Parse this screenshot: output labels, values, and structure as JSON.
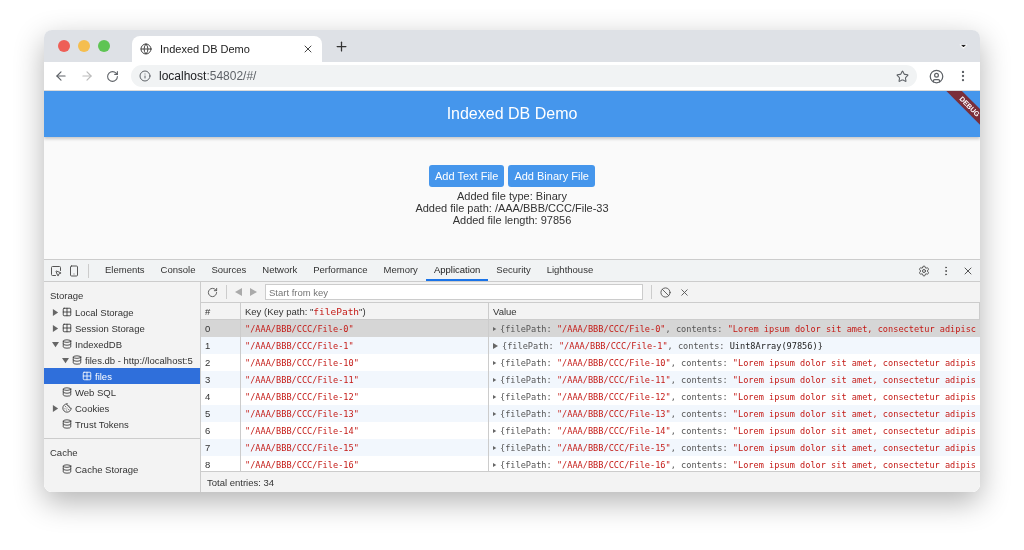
{
  "browser": {
    "tab_title": "Indexed DB Demo",
    "url_host": "localhost",
    "url_rest": ":54802/#/"
  },
  "app": {
    "title": "Indexed DB Demo",
    "debug_banner": "DEBUG",
    "buttons": [
      "Add Text File",
      "Add Binary File"
    ],
    "lines": [
      "Added file type: Binary",
      "Added file path: /AAA/BBB/CCC/File-33",
      "Added file length: 97856"
    ]
  },
  "devtools": {
    "tabs": [
      {
        "label": "Elements",
        "selected": false
      },
      {
        "label": "Console",
        "selected": false
      },
      {
        "label": "Sources",
        "selected": false
      },
      {
        "label": "Network",
        "selected": false
      },
      {
        "label": "Performance",
        "selected": false
      },
      {
        "label": "Memory",
        "selected": false
      },
      {
        "label": "Application",
        "selected": true
      },
      {
        "label": "Security",
        "selected": false
      },
      {
        "label": "Lighthouse",
        "selected": false
      }
    ],
    "sidebar": [
      {
        "heading": "Storage",
        "items": [
          {
            "label": "Local Storage",
            "kind": "grid",
            "expanded": false,
            "selected": false
          },
          {
            "label": "Session Storage",
            "kind": "grid",
            "expanded": false,
            "selected": false
          },
          {
            "label": "IndexedDB",
            "kind": "db",
            "expanded": true,
            "selected": false,
            "children": [
              {
                "label": "files.db - http://localhost:5",
                "kind": "db",
                "expanded": true,
                "selected": false,
                "children": [
                  {
                    "label": "files",
                    "kind": "grid",
                    "selected": true
                  }
                ]
              }
            ]
          },
          {
            "label": "Web SQL",
            "kind": "db",
            "selected": false
          },
          {
            "label": "Cookies",
            "kind": "cookie",
            "expanded": false,
            "selected": false
          },
          {
            "label": "Trust Tokens",
            "kind": "db",
            "selected": false
          }
        ]
      },
      {
        "heading": "Cache",
        "items": [
          {
            "label": "Cache Storage",
            "kind": "db",
            "selected": false
          }
        ]
      }
    ],
    "key_filter": {
      "placeholder": "Start from key"
    },
    "table": {
      "columns": [
        [
          {
            "text": "#",
            "kind": "plain"
          }
        ],
        [
          {
            "text": "Key (Key path: \"",
            "kind": "plain"
          },
          {
            "text": "filePath",
            "kind": "string"
          },
          {
            "text": "\")",
            "kind": "plain"
          }
        ],
        [
          {
            "text": "Value",
            "kind": "plain"
          }
        ]
      ],
      "rows": [
        {
          "index": "0",
          "key": "\"/AAA/BBB/CCC/File-0\"",
          "selected": true,
          "value": [
            {
              "text": "{filePath: ",
              "kind": "plain"
            },
            {
              "text": "\"/AAA/BBB/CCC/File-0\"",
              "kind": "string"
            },
            {
              "text": ", contents: ",
              "kind": "plain"
            },
            {
              "text": "\"Lorem ipsum dolor sit amet, consectetur adipisc",
              "kind": "string"
            }
          ]
        },
        {
          "index": "1",
          "key": "\"/AAA/BBB/CCC/File-1\"",
          "selected": false,
          "value": [
            {
              "text": "{filePath: ",
              "kind": "plain"
            },
            {
              "text": "\"/AAA/BBB/CCC/File-1\"",
              "kind": "string"
            },
            {
              "text": ", contents: ",
              "kind": "plain"
            },
            {
              "text": "Uint8Array(97856)}",
              "kind": "code"
            }
          ]
        },
        {
          "index": "2",
          "key": "\"/AAA/BBB/CCC/File-10\"",
          "selected": false,
          "value": [
            {
              "text": "{filePath: ",
              "kind": "plain"
            },
            {
              "text": "\"/AAA/BBB/CCC/File-10\"",
              "kind": "string"
            },
            {
              "text": ", contents: ",
              "kind": "plain"
            },
            {
              "text": "\"Lorem ipsum dolor sit amet, consectetur adipis",
              "kind": "string"
            }
          ]
        },
        {
          "index": "3",
          "key": "\"/AAA/BBB/CCC/File-11\"",
          "selected": false,
          "value": [
            {
              "text": "{filePath: ",
              "kind": "plain"
            },
            {
              "text": "\"/AAA/BBB/CCC/File-11\"",
              "kind": "string"
            },
            {
              "text": ", contents: ",
              "kind": "plain"
            },
            {
              "text": "\"Lorem ipsum dolor sit amet, consectetur adipis",
              "kind": "string"
            }
          ]
        },
        {
          "index": "4",
          "key": "\"/AAA/BBB/CCC/File-12\"",
          "selected": false,
          "value": [
            {
              "text": "{filePath: ",
              "kind": "plain"
            },
            {
              "text": "\"/AAA/BBB/CCC/File-12\"",
              "kind": "string"
            },
            {
              "text": ", contents: ",
              "kind": "plain"
            },
            {
              "text": "\"Lorem ipsum dolor sit amet, consectetur adipis",
              "kind": "string"
            }
          ]
        },
        {
          "index": "5",
          "key": "\"/AAA/BBB/CCC/File-13\"",
          "selected": false,
          "value": [
            {
              "text": "{filePath: ",
              "kind": "plain"
            },
            {
              "text": "\"/AAA/BBB/CCC/File-13\"",
              "kind": "string"
            },
            {
              "text": ", contents: ",
              "kind": "plain"
            },
            {
              "text": "\"Lorem ipsum dolor sit amet, consectetur adipis",
              "kind": "string"
            }
          ]
        },
        {
          "index": "6",
          "key": "\"/AAA/BBB/CCC/File-14\"",
          "selected": false,
          "value": [
            {
              "text": "{filePath: ",
              "kind": "plain"
            },
            {
              "text": "\"/AAA/BBB/CCC/File-14\"",
              "kind": "string"
            },
            {
              "text": ", contents: ",
              "kind": "plain"
            },
            {
              "text": "\"Lorem ipsum dolor sit amet, consectetur adipis",
              "kind": "string"
            }
          ]
        },
        {
          "index": "7",
          "key": "\"/AAA/BBB/CCC/File-15\"",
          "selected": false,
          "value": [
            {
              "text": "{filePath: ",
              "kind": "plain"
            },
            {
              "text": "\"/AAA/BBB/CCC/File-15\"",
              "kind": "string"
            },
            {
              "text": ", contents: ",
              "kind": "plain"
            },
            {
              "text": "\"Lorem ipsum dolor sit amet, consectetur adipis",
              "kind": "string"
            }
          ]
        },
        {
          "index": "8",
          "key": "\"/AAA/BBB/CCC/File-16\"",
          "selected": false,
          "value": [
            {
              "text": "{filePath: ",
              "kind": "plain"
            },
            {
              "text": "\"/AAA/BBB/CCC/File-16\"",
              "kind": "string"
            },
            {
              "text": ", contents: ",
              "kind": "plain"
            },
            {
              "text": "\"Lorem ipsum dolor sit amet, consectetur adipis",
              "kind": "string"
            }
          ]
        }
      ]
    },
    "status": "Total entries: 34"
  }
}
